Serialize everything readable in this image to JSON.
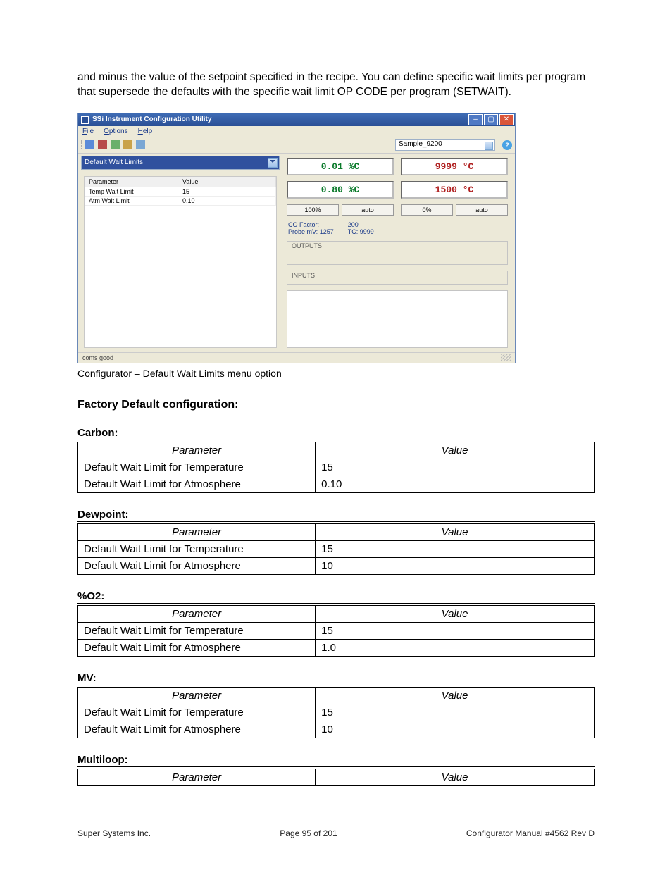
{
  "intro": "and minus the value of the setpoint specified in the recipe. You can define specific wait limits per program that supersede the defaults with the specific wait limit OP CODE per program (SETWAIT).",
  "screenshot": {
    "title": "SSi Instrument Configuration Utility",
    "menus": {
      "file": "File",
      "options": "Options",
      "help": "Help"
    },
    "sample_combo": "Sample_9200",
    "dropdown_label": "Default Wait Limits",
    "param_table": {
      "headers": {
        "param": "Parameter",
        "value": "Value"
      },
      "rows": [
        {
          "param": "Temp Wait Limit",
          "value": "15"
        },
        {
          "param": "Atm Wait Limit",
          "value": "0.10"
        }
      ]
    },
    "readouts": {
      "c_pv": "0.01 %C",
      "t_pv": "9999 °C",
      "c_sp": "0.80 %C",
      "t_sp": "1500 °C"
    },
    "buttons": {
      "left1": "100%",
      "left2": "auto",
      "right1": "0%",
      "right2": "auto"
    },
    "info": {
      "left1": "CO Factor:",
      "left2": "Probe mV: 1257",
      "right1": "200",
      "right2": "TC: 9999"
    },
    "groups": {
      "outputs": "OUTPUTS",
      "inputs": "INPUTS"
    },
    "status": "coms good"
  },
  "caption": "Configurator – Default Wait Limits menu option",
  "factory_heading": "Factory Default configuration:",
  "sections": [
    {
      "name": "Carbon:",
      "rows": [
        {
          "param": "Default Wait Limit for Temperature",
          "value": "15"
        },
        {
          "param": "Default Wait Limit for Atmosphere",
          "value": "0.10"
        }
      ]
    },
    {
      "name": "Dewpoint:",
      "rows": [
        {
          "param": "Default Wait Limit for Temperature",
          "value": "15"
        },
        {
          "param": "Default Wait Limit for Atmosphere",
          "value": "10"
        }
      ]
    },
    {
      "name": "%O2:",
      "rows": [
        {
          "param": "Default Wait Limit for Temperature",
          "value": "15"
        },
        {
          "param": "Default Wait Limit for Atmosphere",
          "value": "1.0"
        }
      ]
    },
    {
      "name": "MV:",
      "rows": [
        {
          "param": "Default Wait Limit for Temperature",
          "value": "15"
        },
        {
          "param": "Default Wait Limit for Atmosphere",
          "value": "10"
        }
      ]
    },
    {
      "name": "Multiloop:",
      "rows": []
    }
  ],
  "table_headers": {
    "param": "Parameter",
    "value": "Value"
  },
  "footer": {
    "left": "Super Systems Inc.",
    "center": "Page 95 of 201",
    "right": "Configurator Manual #4562 Rev D"
  }
}
